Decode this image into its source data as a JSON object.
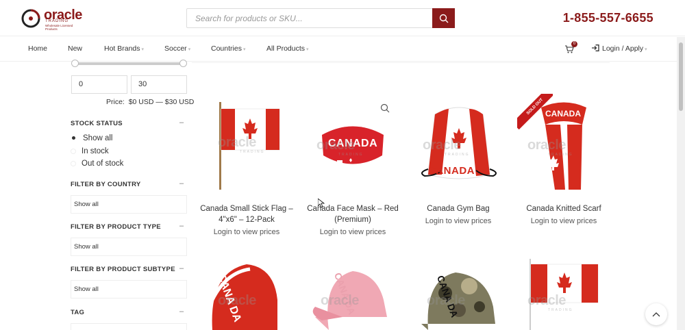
{
  "header": {
    "logo_word": "oracle",
    "logo_sub": "TRADING",
    "logo_tagline": "Wholesale Licensed Products",
    "search_placeholder": "Search for products or SKU...",
    "phone": "1-855-557-6655"
  },
  "nav": {
    "items": [
      {
        "label": "Home"
      },
      {
        "label": "New"
      },
      {
        "label": "Hot Brands"
      },
      {
        "label": "Soccer"
      },
      {
        "label": "Countries"
      },
      {
        "label": "All Products"
      }
    ],
    "cart_count": "0",
    "login_label": "Login / Apply"
  },
  "sidebar": {
    "price_min": "0",
    "price_max": "30",
    "price_label": "Price:",
    "price_range": "$0 USD — $30 USD",
    "stock_status": {
      "heading": "STOCK STATUS",
      "options": [
        "Show all",
        "In stock",
        "Out of stock"
      ],
      "selected": "Show all"
    },
    "filter_country": {
      "heading": "FILTER BY COUNTRY",
      "value": "Show all"
    },
    "filter_type": {
      "heading": "FILTER BY PRODUCT TYPE",
      "value": "Show all"
    },
    "filter_subtype": {
      "heading": "FILTER BY PRODUCT SUBTYPE",
      "value": "Show all"
    },
    "tag": {
      "heading": "TAG"
    }
  },
  "products": [
    {
      "title_line1": "Canada Small Stick Flag –",
      "title_line2": "4\"x6\" – 12-Pack",
      "price_note": "Login to view prices"
    },
    {
      "title_line1": "Canada Face Mask – Red",
      "title_line2": "(Premium)",
      "price_note": "Login to view prices"
    },
    {
      "title_line1": "Canada Gym Bag",
      "title_line2": "",
      "price_note": "Login to view prices"
    },
    {
      "title_line1": "Canada Knitted Scarf",
      "title_line2": "",
      "price_note": "Login to view prices",
      "badge": "SOLD OUT"
    }
  ],
  "product_art": {
    "canada_text": "CANADA",
    "cap_text": "CANA DA"
  },
  "watermark": {
    "word": "oracle",
    "sub": "TRADING"
  },
  "colors": {
    "brand": "#8b1b1b",
    "flag_red": "#d52b1e",
    "badge_red": "#c51b1b"
  }
}
